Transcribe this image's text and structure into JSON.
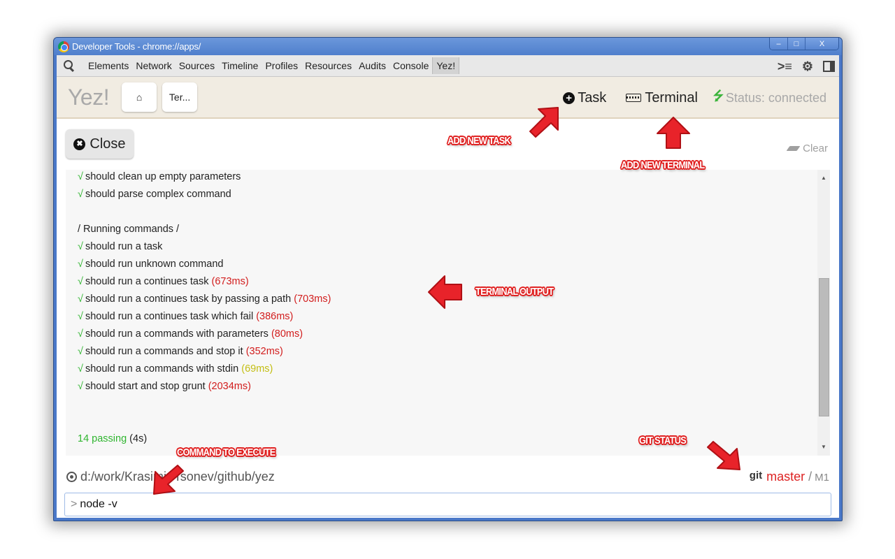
{
  "window": {
    "title": "Developer Tools - chrome://apps/",
    "controls": {
      "minimize": "–",
      "maximize": "□",
      "close": "X"
    }
  },
  "devtools": {
    "tabs": [
      {
        "label": "Elements"
      },
      {
        "label": "Network"
      },
      {
        "label": "Sources"
      },
      {
        "label": "Timeline"
      },
      {
        "label": "Profiles"
      },
      {
        "label": "Resources"
      },
      {
        "label": "Audits"
      },
      {
        "label": "Console"
      },
      {
        "label": "Yez!",
        "active": true
      }
    ],
    "icons": {
      "search": "search-icon",
      "drawer": "console-drawer-icon",
      "settings": "gear-icon",
      "dock": "dock-icon"
    }
  },
  "app": {
    "logo": "Yez!",
    "breadcrumbs": [
      {
        "icon": "home-icon",
        "label": ""
      },
      {
        "label": "Ter..."
      }
    ],
    "header": {
      "add_task_label": "Task",
      "add_terminal_label": "Terminal",
      "status_label": "Status: connected",
      "status_color": "#3cb43c"
    },
    "close_label": "Close",
    "clear_label": "Clear"
  },
  "terminal": {
    "lines": [
      {
        "type": "pass",
        "text": "should clean up empty parameters",
        "duration": "",
        "duration_color": ""
      },
      {
        "type": "pass",
        "text": "should parse complex command",
        "duration": "",
        "duration_color": ""
      },
      {
        "type": "blank",
        "text": ""
      },
      {
        "type": "heading",
        "text": "/ Running commands /"
      },
      {
        "type": "pass",
        "text": "should run a task",
        "duration": "",
        "duration_color": ""
      },
      {
        "type": "pass",
        "text": "should run unknown command",
        "duration": "",
        "duration_color": ""
      },
      {
        "type": "pass",
        "text": "should run a continues task",
        "duration": "(673ms)",
        "duration_color": "red"
      },
      {
        "type": "pass",
        "text": "should run a continues task by passing a path",
        "duration": "(703ms)",
        "duration_color": "red"
      },
      {
        "type": "pass",
        "text": "should run a continues task which fail",
        "duration": "(386ms)",
        "duration_color": "red"
      },
      {
        "type": "pass",
        "text": "should run a commands with parameters",
        "duration": "(80ms)",
        "duration_color": "red"
      },
      {
        "type": "pass",
        "text": "should run a commands and stop it",
        "duration": "(352ms)",
        "duration_color": "red"
      },
      {
        "type": "pass",
        "text": "should run a commands with stdin",
        "duration": "(69ms)",
        "duration_color": "yellow"
      },
      {
        "type": "pass",
        "text": "should start and stop grunt",
        "duration": "(2034ms)",
        "duration_color": "red"
      },
      {
        "type": "blank",
        "text": ""
      },
      {
        "type": "blank",
        "text": ""
      },
      {
        "type": "summary",
        "passing": "14 passing",
        "time": "(4s)"
      }
    ],
    "check_glyph": "√",
    "scroll_position": 0.6
  },
  "footer": {
    "cwd": "d:/work/Krasimir Tsonev/github/yez",
    "git": {
      "label": "git",
      "branch": "master",
      "separator": "/",
      "modified": "M1"
    },
    "prompt": ">",
    "command_value": "node -v",
    "command_placeholder": ""
  },
  "annotations": [
    {
      "id": "add-new-task",
      "text": "ADD NEW TASK"
    },
    {
      "id": "add-new-terminal",
      "text": "ADD NEW TERMINAL"
    },
    {
      "id": "terminal-output",
      "text": "TERMINAL OUTPUT"
    },
    {
      "id": "command-to-execute",
      "text": "COMMAND TO EXECUTE"
    },
    {
      "id": "git-status",
      "text": "GIT STATUS"
    }
  ]
}
